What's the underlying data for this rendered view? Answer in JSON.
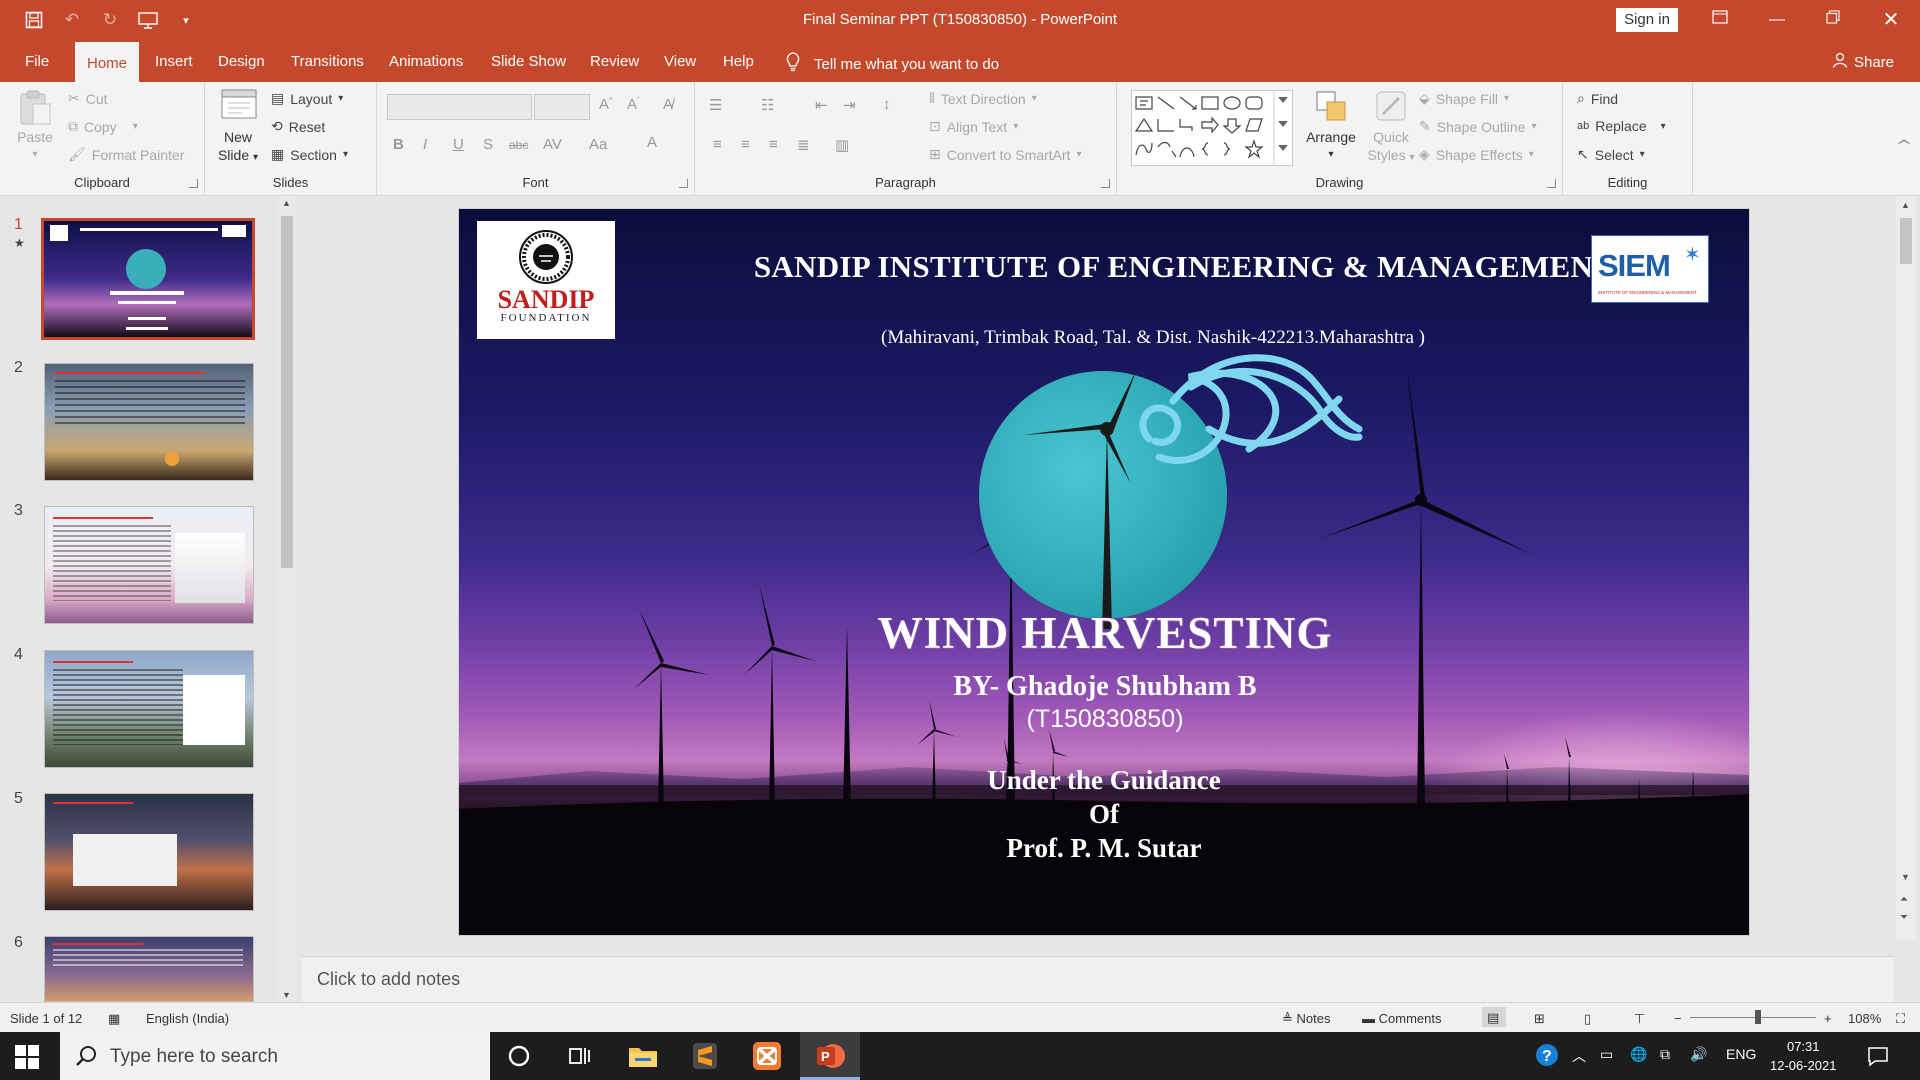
{
  "window": {
    "title": "Final Seminar PPT (T150830850)  -  PowerPoint",
    "signin_label": "Sign in",
    "qat_icons": [
      "save-icon",
      "undo-icon",
      "redo-icon",
      "present-icon",
      "customize-icon"
    ]
  },
  "ribbon": {
    "tabs": [
      "File",
      "Home",
      "Insert",
      "Design",
      "Transitions",
      "Animations",
      "Slide Show",
      "Review",
      "View",
      "Help"
    ],
    "active_tab": "Home",
    "tell_me": "Tell me what you want to do",
    "share_label": "Share",
    "clipboard": {
      "label": "Clipboard",
      "paste": "Paste",
      "cut": "Cut",
      "copy": "Copy",
      "format_painter": "Format Painter"
    },
    "slides": {
      "label": "Slides",
      "new_slide_1": "New",
      "new_slide_2": "Slide",
      "layout": "Layout",
      "reset": "Reset",
      "section": "Section"
    },
    "font": {
      "label": "Font"
    },
    "paragraph": {
      "label": "Paragraph",
      "text_direction": "Text Direction",
      "align_text": "Align Text",
      "convert_smartart": "Convert to SmartArt"
    },
    "drawing": {
      "label": "Drawing",
      "arrange": "Arrange",
      "quick_1": "Quick",
      "quick_2": "Styles",
      "shape_fill": "Shape Fill",
      "shape_outline": "Shape Outline",
      "shape_effects": "Shape Effects"
    },
    "editing": {
      "label": "Editing",
      "find": "Find",
      "replace": "Replace",
      "select": "Select"
    }
  },
  "thumbnails": {
    "numbers": [
      "1",
      "2",
      "3",
      "4",
      "5",
      "6"
    ],
    "selected": 1,
    "star": "★"
  },
  "slide": {
    "institute": "SANDIP INSTITUTE OF ENGINEERING & MANAGEMENT",
    "address": "(Mahiravani, Trimbak Road, Tal. & Dist. Nashik-422213.Maharashtra )",
    "logo_left_1": "SANDIP",
    "logo_left_2": "FOUNDATION",
    "logo_right": "SIEM",
    "logo_right_sub": "INSTITUTE OF ENGINEERING & MANAGEMENT",
    "title": "WIND HARVESTING",
    "by": "BY- Ghadoje Shubham B",
    "roll": "(T150830850)",
    "guidance_1": "Under the Guidance",
    "guidance_2": "Of",
    "guidance_3": "Prof. P. M. Sutar"
  },
  "notes_placeholder": "Click to add notes",
  "status": {
    "slide_info": "Slide 1 of 12",
    "language": "English (India)",
    "notes": "Notes",
    "comments": "Comments",
    "zoom": "108%",
    "zoom_level": 0.54
  },
  "taskbar": {
    "search_placeholder": "Type here to search",
    "language": "ENG",
    "time": "07:31",
    "date": "12-06-2021"
  }
}
